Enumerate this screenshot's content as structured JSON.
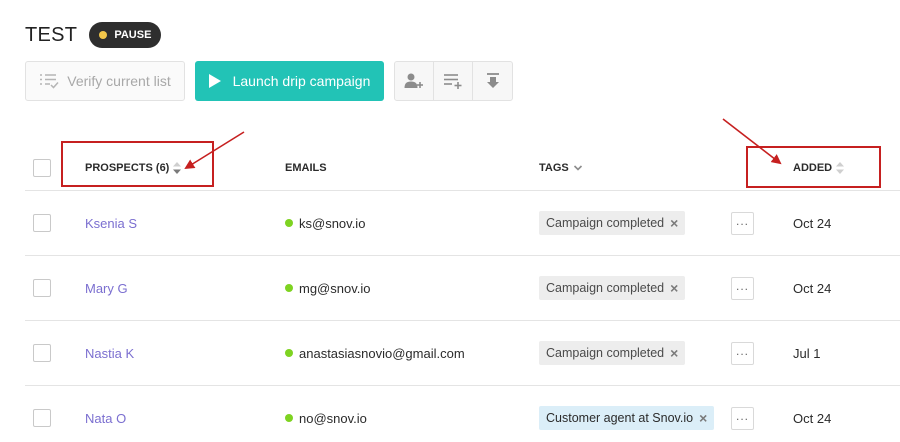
{
  "header": {
    "title": "TEST",
    "status": "PAUSE"
  },
  "toolbar": {
    "verify_label": "Verify current list",
    "launch_label": "Launch drip campaign",
    "icons": [
      "add-prospect-icon",
      "add-to-list-icon",
      "download-icon"
    ]
  },
  "table": {
    "columns": {
      "prospects": "PROSPECTS (6)",
      "emails": "EMAILS",
      "tags": "TAGS",
      "added": "ADDED"
    },
    "rows": [
      {
        "name": "Ksenia S",
        "email": "ks@snov.io",
        "tag": "Campaign completed",
        "added": "Oct 24"
      },
      {
        "name": "Mary G",
        "email": "mg@snov.io",
        "tag": "Campaign completed",
        "added": "Oct 24"
      },
      {
        "name": "Nastia K",
        "email": "anastasiasnovio@gmail.com",
        "tag": "Campaign completed",
        "added": "Jul 1"
      },
      {
        "name": "Nata O",
        "email": "no@snov.io",
        "tag": "Customer agent at Snov.io",
        "added": "Oct 24"
      }
    ]
  },
  "colors": {
    "accent": "#22c3b6",
    "link": "#7b6fd0",
    "status_dot": "#f3c74a",
    "email_valid": "#7ed321",
    "annotation": "#c62020"
  }
}
